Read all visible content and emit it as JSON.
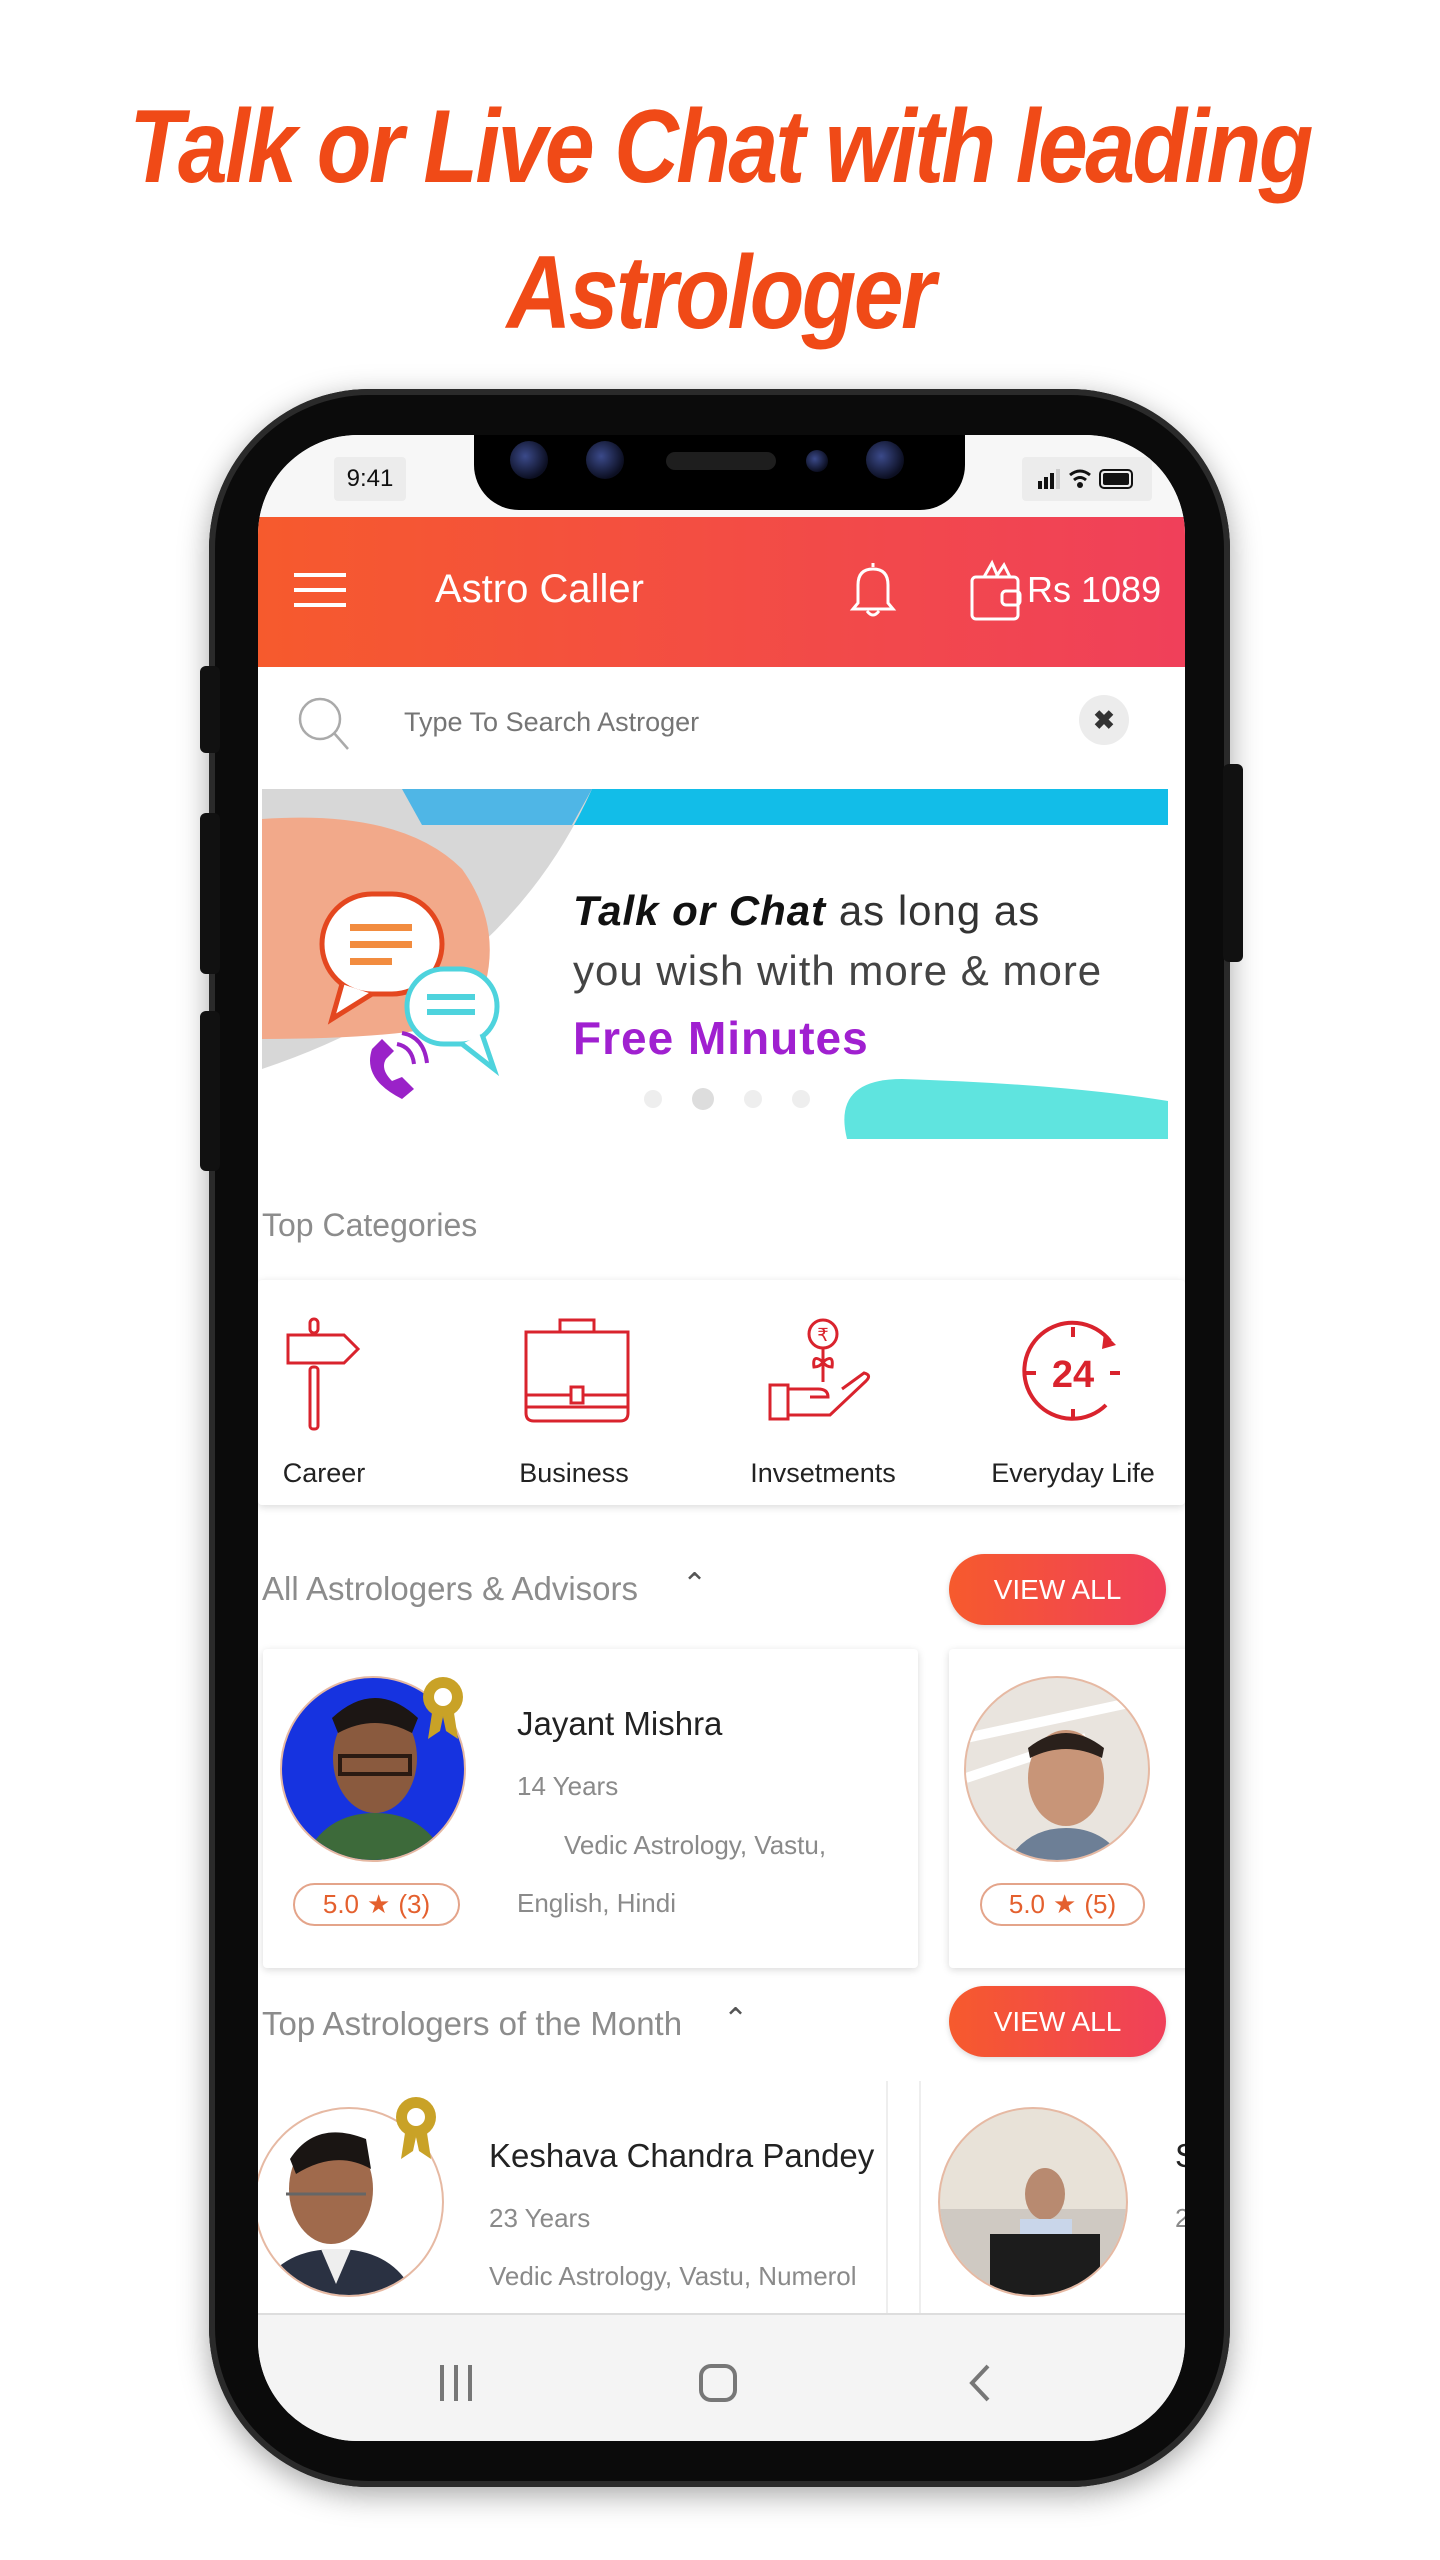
{
  "headline": {
    "line1": "Talk or Live Chat with leading",
    "line2": "Astrologer"
  },
  "status_bar": {
    "time": "9:41"
  },
  "app_header": {
    "title": "Astro Caller",
    "wallet_balance": "Rs 1089",
    "icons": [
      "menu-icon",
      "bell-icon",
      "wallet-icon"
    ]
  },
  "search": {
    "placeholder": "Type To Search Astroger"
  },
  "banner": {
    "text_bold": "Talk or Chat",
    "text1_rest": " as long as",
    "text2": "you wish with more & more",
    "highlight": "Free Minutes",
    "active_slide": 2,
    "slide_count": 4
  },
  "categories": {
    "title": "Top Categories",
    "items": [
      {
        "label": "Career",
        "icon": "signpost-icon"
      },
      {
        "label": "Business",
        "icon": "briefcase-icon"
      },
      {
        "label": "Invsetments",
        "icon": "money-plant-hand-icon"
      },
      {
        "label": "Everyday Life",
        "icon": "24-hours-icon"
      }
    ]
  },
  "all_astrologers": {
    "title": "All Astrologers & Advisors",
    "view_all": "VIEW ALL",
    "cards": [
      {
        "name": "Jayant Mishra",
        "experience": "14 Years",
        "skills": "Vedic Astrology, Vastu,",
        "languages": "English, Hindi",
        "rating": "5.0",
        "reviews": "(3)"
      },
      {
        "rating": "5.0",
        "reviews": "(5)"
      }
    ]
  },
  "top_astrologers": {
    "title": "Top Astrologers of the Month",
    "view_all": "VIEW ALL",
    "cards": [
      {
        "name": "Keshava Chandra Pandey",
        "experience": "23 Years",
        "skills": "Vedic Astrology, Vastu, Numerol"
      },
      {
        "name_partial": "S",
        "experience_partial": "2"
      }
    ]
  },
  "colors": {
    "accent": "#f04a17",
    "header_start": "#f65a2d",
    "header_end": "#f0405a",
    "highlight": "#a020d0",
    "icon_red": "#d9232d"
  }
}
